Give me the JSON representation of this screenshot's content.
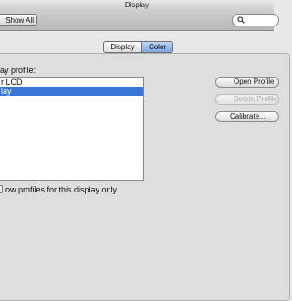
{
  "window": {
    "title": "Display"
  },
  "toolbar": {
    "show_all_label": "Show All",
    "search_placeholder": ""
  },
  "tabs": [
    {
      "label": "Display",
      "selected": false
    },
    {
      "label": "Color",
      "selected": true
    }
  ],
  "color_panel": {
    "profile_label": "ay profile:",
    "profiles": [
      {
        "label": "r LCD",
        "selected": false
      },
      {
        "label": "lay",
        "selected": true
      }
    ],
    "show_profiles_checkbox": {
      "label": "ow profiles for this display only",
      "checked": false
    },
    "buttons": {
      "open_profile": "Open Profile",
      "delete_profile": "Delete Profile",
      "calibrate": "Calibrate..."
    }
  },
  "colors": {
    "selection": "#3875d7",
    "segment_selected": "#7fa7e0"
  }
}
